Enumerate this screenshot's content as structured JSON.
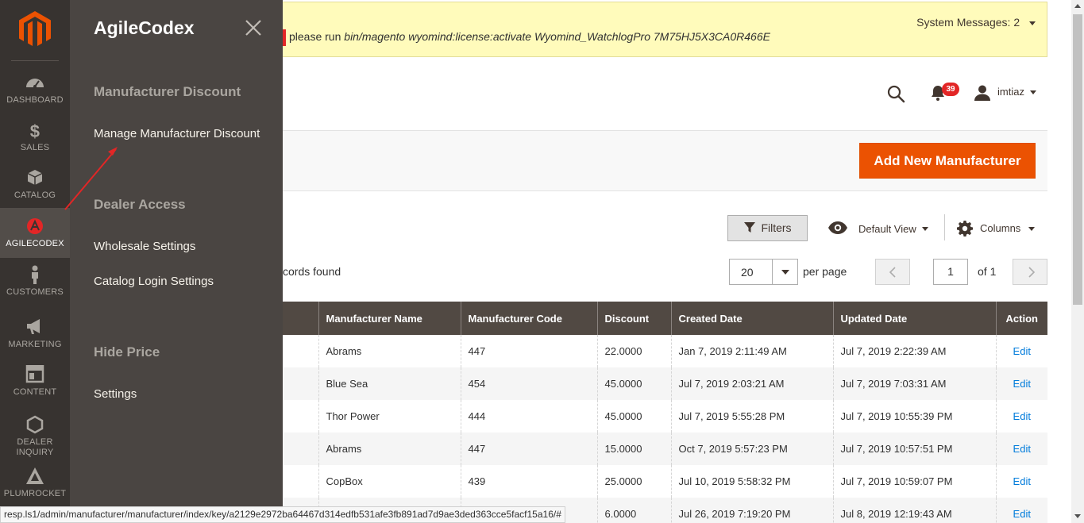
{
  "nav": {
    "items": [
      {
        "label": "DASHBOARD",
        "icon": "dashboard-icon"
      },
      {
        "label": "SALES",
        "icon": "dollar-icon"
      },
      {
        "label": "CATALOG",
        "icon": "box-icon"
      },
      {
        "label": "AGILECODEX",
        "icon": "agilecodex-icon",
        "active": true
      },
      {
        "label": "CUSTOMERS",
        "icon": "person-icon"
      },
      {
        "label": "MARKETING",
        "icon": "megaphone-icon"
      },
      {
        "label": "CONTENT",
        "icon": "layout-icon"
      },
      {
        "label": "DEALER INQUIRY",
        "icon": "hexagon-icon"
      },
      {
        "label": "PLUMROCKET",
        "icon": "plumrocket-icon"
      }
    ]
  },
  "submenu": {
    "title": "AgileCodex",
    "sections": [
      {
        "heading": "Manufacturer Discount",
        "links": [
          "Manage Manufacturer Discount"
        ]
      },
      {
        "heading": "Dealer Access",
        "links": [
          "Wholesale Settings",
          "Catalog Login Settings"
        ]
      },
      {
        "heading": "Hide Price",
        "links": [
          "Settings"
        ]
      }
    ]
  },
  "messages": {
    "prefix": "please run ",
    "command": "bin/magento wyomind:license:activate Wyomind_WatchlogPro 7M75HJ5X3CA0R466E",
    "system_messages": "System Messages: 2"
  },
  "header": {
    "notifications_count": "39",
    "user_name": "imtiaz"
  },
  "actions": {
    "add_new": "Add New Manufacturer"
  },
  "toolbar": {
    "filters": "Filters",
    "view": "Default View",
    "columns": "Columns",
    "records_found": "cords found",
    "per_page_value": "20",
    "per_page_label": "per page",
    "page_value": "1",
    "page_of": "of 1"
  },
  "grid": {
    "columns": [
      "Manufacturer Name",
      "Manufacturer Code",
      "Discount",
      "Created Date",
      "Updated Date",
      "Action"
    ],
    "rows": [
      {
        "name": "Abrams",
        "code": "447",
        "discount": "22.0000",
        "created": "Jan 7, 2019 2:11:49 AM",
        "updated": "Jul 7, 2019 2:22:39 AM",
        "action": "Edit"
      },
      {
        "name": "Blue Sea",
        "code": "454",
        "discount": "45.0000",
        "created": "Jul 7, 2019 2:03:21 AM",
        "updated": "Jul 7, 2019 7:03:31 AM",
        "action": "Edit"
      },
      {
        "name": "Thor Power",
        "code": "444",
        "discount": "45.0000",
        "created": "Jul 7, 2019 5:55:28 PM",
        "updated": "Jul 7, 2019 10:55:39 PM",
        "action": "Edit"
      },
      {
        "name": "Abrams",
        "code": "447",
        "discount": "15.0000",
        "created": "Oct 7, 2019 5:57:23 PM",
        "updated": "Jul 7, 2019 10:57:51 PM",
        "action": "Edit"
      },
      {
        "name": "CopBox",
        "code": "439",
        "discount": "25.0000",
        "created": "Jul 10, 2019 5:58:32 PM",
        "updated": "Jul 7, 2019 10:59:07 PM",
        "action": "Edit"
      },
      {
        "name": "",
        "code": "",
        "discount": "6.0000",
        "created": "Jul 26, 2019 7:19:20 PM",
        "updated": "Jul 8, 2019 12:19:43 AM",
        "action": "Edit"
      }
    ]
  },
  "statusbar": {
    "url": "resp.ls1/admin/manufacturer/manufacturer/index/key/a2129e2972ba64467d314edfb531afe3fb891ad7d9ae3ded363cce5facf15a16/#"
  },
  "colors": {
    "nav_bg": "#373330",
    "submenu_bg": "#4a4542",
    "accent_orange": "#eb5202",
    "grid_header": "#514943",
    "link_blue": "#007bdb",
    "badge_red": "#e22626",
    "message_bg": "#fffbbb"
  }
}
